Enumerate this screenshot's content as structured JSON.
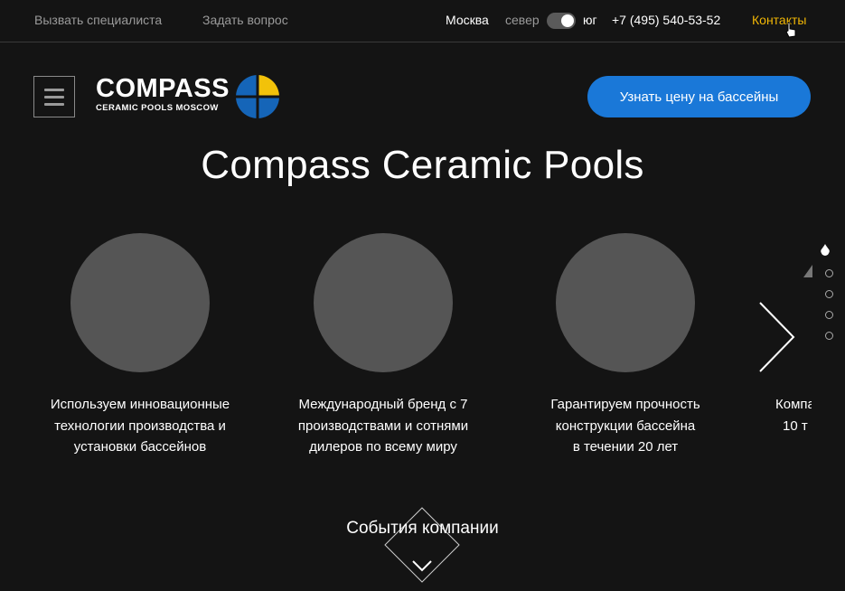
{
  "topbar": {
    "call_specialist": "Вызвать специалиста",
    "ask_question": "Задать вопрос",
    "city": "Москва",
    "region_north": "север",
    "region_south": "юг",
    "phone": "+7 (495) 540-53-52",
    "contacts": "Контакты"
  },
  "header": {
    "logo_main": "COMPASS",
    "logo_sub": "CERAMIC POOLS MOSCOW",
    "cta_label": "Узнать цену на бассейны"
  },
  "hero": {
    "title": "Compass Ceramic Pools"
  },
  "features": [
    {
      "line1": "Используем инновационные",
      "line2": "технологии производства и",
      "line3": "установки бассейнов"
    },
    {
      "line1": "Международный бренд с 7",
      "line2": "производствами и сотнями",
      "line3": "дилеров по всему миру"
    },
    {
      "line1": "Гарантируем прочность",
      "line2": "конструкции бассейна",
      "line3": "в течении 20 лет"
    },
    {
      "line1": "Компа",
      "line2": "10 т"
    }
  ],
  "events": {
    "label": "События компании"
  },
  "colors": {
    "accent_blue": "#1a78d8",
    "accent_yellow": "#f2b705",
    "background": "#141414"
  }
}
